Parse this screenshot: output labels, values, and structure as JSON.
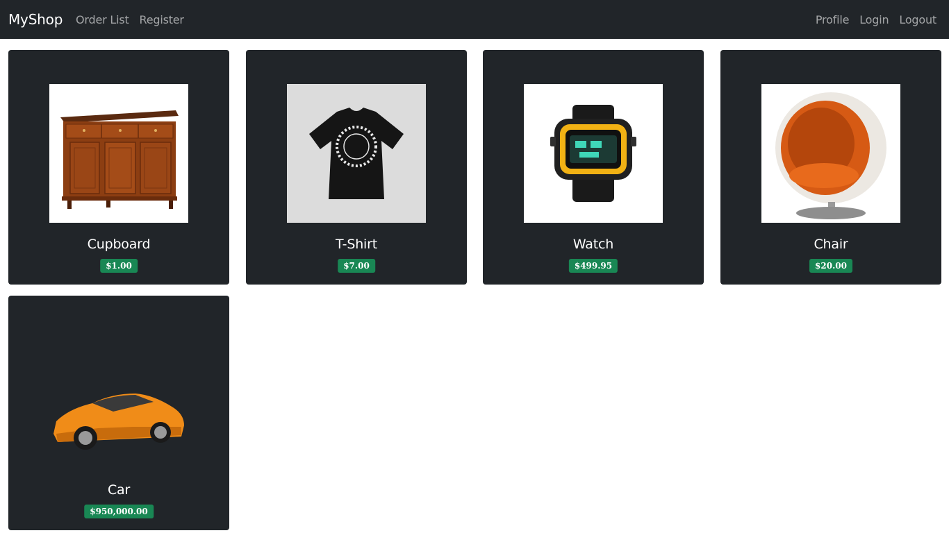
{
  "navbar": {
    "brand": "MyShop",
    "left_links": [
      "Order List",
      "Register"
    ],
    "right_links": [
      "Profile",
      "Login",
      "Logout"
    ]
  },
  "products": [
    {
      "name": "Cupboard",
      "price": "$1.00",
      "image": "cupboard-image"
    },
    {
      "name": "T-Shirt",
      "price": "$7.00",
      "image": "tshirt-image"
    },
    {
      "name": "Watch",
      "price": "$499.95",
      "image": "watch-image"
    },
    {
      "name": "Chair",
      "price": "$20.00",
      "image": "chair-image"
    },
    {
      "name": "Car",
      "price": "$950,000.00",
      "image": "car-image"
    }
  ],
  "colors": {
    "navbar_bg": "#212529",
    "card_bg": "#212529",
    "badge_bg": "#198754"
  }
}
